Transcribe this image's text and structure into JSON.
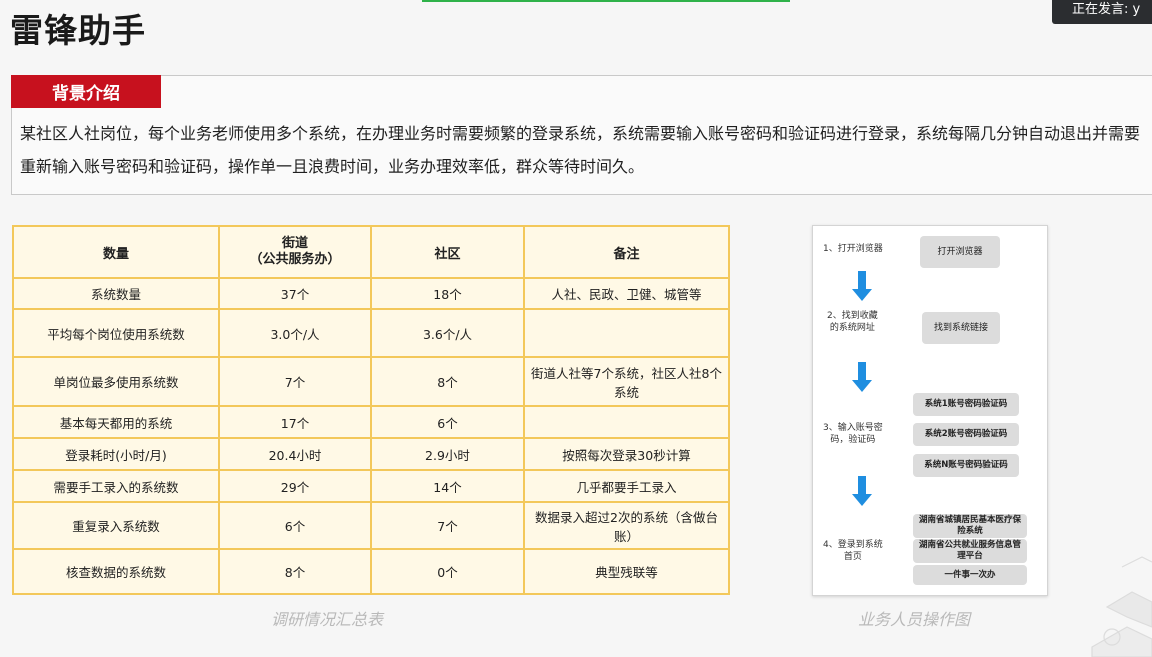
{
  "window": {
    "speaking_label": "正在发言: y"
  },
  "slide": {
    "title": "雷锋助手",
    "background": {
      "tag": "背景介绍",
      "text": "某社区人社岗位，每个业务老师使用多个系统，在办理业务时需要频繁的登录系统，系统需要输入账号密码和验证码进行登录，系统每隔几分钟自动退出并需要重新输入账号密码和验证码，操作单一且浪费时间，业务办理效率低，群众等待时间久。"
    },
    "table": {
      "headers": [
        "数量",
        "街道\n（公共服务办）",
        "社区",
        "备注"
      ],
      "rows": [
        [
          "系统数量",
          "37个",
          "18个",
          "人社、民政、卫健、城管等"
        ],
        [
          "平均每个岗位使用系统数",
          "3.0个/人",
          "3.6个/人",
          ""
        ],
        [
          "单岗位最多使用系统数",
          "7个",
          "8个",
          "街道人社等7个系统，社区人社8个系统"
        ],
        [
          "基本每天都用的系统",
          "17个",
          "6个",
          ""
        ],
        [
          "登录耗时(小时/月)",
          "20.4小时",
          "2.9小时",
          "按照每次登录30秒计算"
        ],
        [
          "需要手工录入的系统数",
          "29个",
          "14个",
          "几乎都要手工录入"
        ],
        [
          "重复录入系统数",
          "6个",
          "7个",
          "数据录入超过2次的系统（含做台账）"
        ],
        [
          "核查数据的系统数",
          "8个",
          "0个",
          "典型残联等"
        ]
      ],
      "caption": "调研情况汇总表"
    },
    "flow": {
      "steps": {
        "s1": "1、打开浏览器",
        "s2": "2、找到收藏\n的系统网址",
        "s3": "3、输入账号密\n码，验证码",
        "s4": "4、登录到系统\n首页"
      },
      "boxes": {
        "b1": "打开浏览器",
        "b2": "找到系统链接",
        "b3a": "系统1账号密码验证码",
        "b3b": "系统2账号密码验证码",
        "b3c": "系统N账号密码验证码",
        "b4a": "湖南省城镇居民基本医疗保险系统",
        "b4b": "湖南省公共就业服务信息管理平台",
        "b4c": "一件事一次办"
      },
      "caption": "业务人员操作图"
    }
  },
  "colors": {
    "tag": "#c7111e",
    "table_border": "#f3c85a",
    "table_bg": "#fff9e6",
    "arrow": "#1f8ee0"
  }
}
